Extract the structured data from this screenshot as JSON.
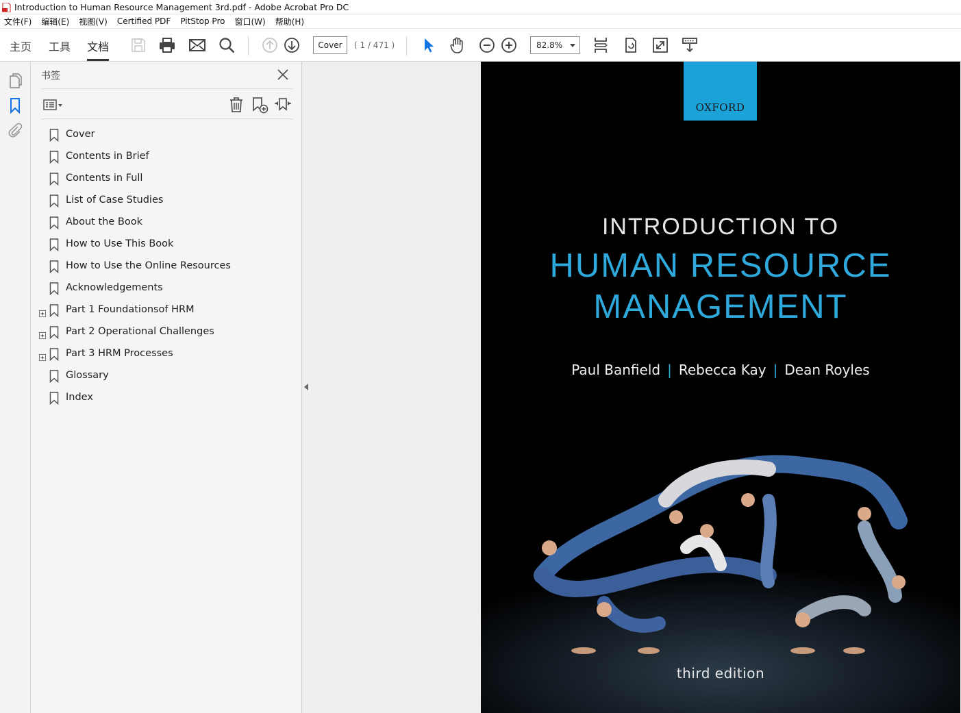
{
  "window": {
    "title": "Introduction to Human Resource Management 3rd.pdf - Adobe Acrobat Pro DC"
  },
  "menu": [
    "文件(F)",
    "编辑(E)",
    "视图(V)",
    "Certified PDF",
    "PitStop Pro",
    "窗口(W)",
    "帮助(H)"
  ],
  "toolbar": {
    "tabs": [
      "主页",
      "工具",
      "文档"
    ],
    "active_tab": "文档",
    "page_field": "Cover",
    "page_count": "( 1 / 471 )",
    "zoom": "82.8%"
  },
  "bookmarks_panel": {
    "title": "书签",
    "items": [
      {
        "label": "Cover",
        "expandable": false
      },
      {
        "label": "Contents in Brief",
        "expandable": false
      },
      {
        "label": "Contents in Full",
        "expandable": false
      },
      {
        "label": "List of Case Studies",
        "expandable": false
      },
      {
        "label": "About the Book",
        "expandable": false
      },
      {
        "label": "How to Use This Book",
        "expandable": false
      },
      {
        "label": "How to Use the Online Resources",
        "expandable": false
      },
      {
        "label": "Acknowledgements",
        "expandable": false
      },
      {
        "label": "Part 1 Foundationsof HRM",
        "expandable": true
      },
      {
        "label": "Part 2 Operational Challenges",
        "expandable": true
      },
      {
        "label": "Part 3 HRM Processes",
        "expandable": true
      },
      {
        "label": "Glossary",
        "expandable": false
      },
      {
        "label": "Index",
        "expandable": false
      }
    ]
  },
  "cover": {
    "publisher": "OXFORD",
    "title_line1": "INTRODUCTION TO",
    "title_line2": "HUMAN RESOURCE",
    "title_line3": "MANAGEMENT",
    "authors": [
      "Paul Banfield",
      "Rebecca Kay",
      "Dean Royles"
    ],
    "author_separator": "|",
    "edition": "third edition"
  },
  "colors": {
    "accent_blue": "#2fa9dc",
    "oxford_box": "#1aa2d9",
    "active_icon": "#1473e6"
  }
}
